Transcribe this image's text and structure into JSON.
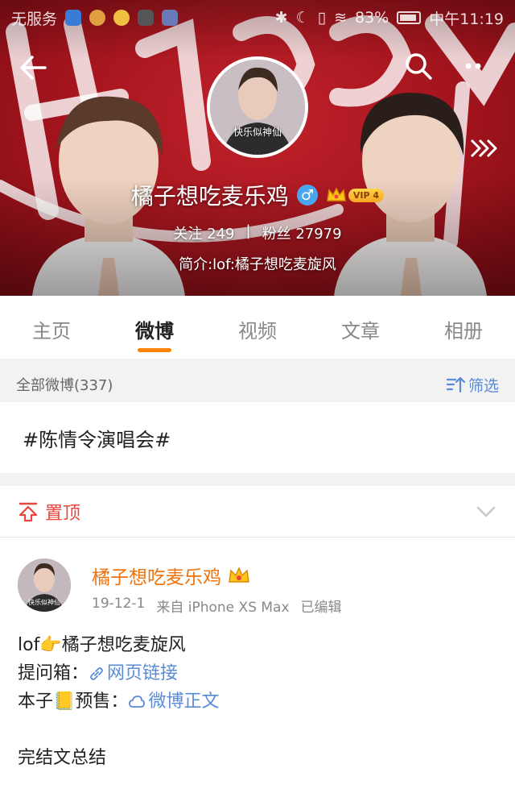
{
  "status_bar": {
    "carrier": "无服务",
    "battery": "83%",
    "time": "中午11:19"
  },
  "profile": {
    "avatar_caption": "快乐似神仙",
    "name": "橘子想吃麦乐鸡",
    "gender_symbol": "♂",
    "vip_label": "VIP 4",
    "following_label": "关注",
    "following_count": "249",
    "divider": "|",
    "fans_label": "粉丝",
    "fans_count": "27979",
    "bio": "简介:lof:橘子想吃麦旋风"
  },
  "tabs": [
    {
      "label": "主页"
    },
    {
      "label": "微博"
    },
    {
      "label": "视频"
    },
    {
      "label": "文章"
    },
    {
      "label": "相册"
    }
  ],
  "filter_bar": {
    "label": "全部微博(337)",
    "filter_label": "筛选"
  },
  "hashtag": "#陈情令演唱会#",
  "pinned": {
    "label": "置顶"
  },
  "post": {
    "avatar_caption": "快乐似神仙",
    "author": "橘子想吃麦乐鸡",
    "date": "19-12-1",
    "source": "来自 iPhone XS Max",
    "edited": "已编辑",
    "line1_prefix": "lof",
    "line1_emoji": "👉",
    "line1_text": "橘子想吃麦旋风",
    "line2_label": "提问箱：",
    "line2_link": "网页链接",
    "line3_prefix": "本子",
    "line3_emoji": "📒",
    "line3_label": "预售：",
    "line3_link": "微博正文",
    "line4": "完结文总结"
  },
  "colors": {
    "accent_orange": "#ff8200",
    "link_blue": "#5a8bd6",
    "pinned_red": "#e8453c",
    "banner_red": "#a3141d"
  }
}
